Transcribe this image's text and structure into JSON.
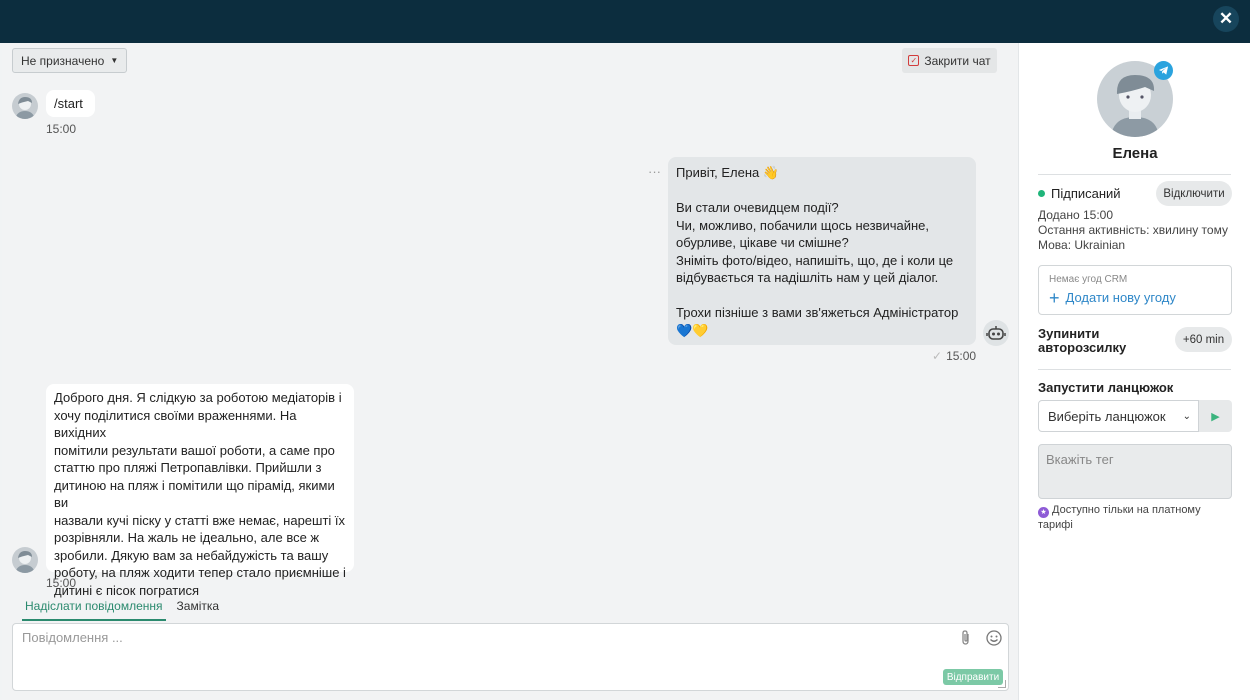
{
  "window": {
    "close_symbol": "✕"
  },
  "toolbar": {
    "assign_label": "Не призначено",
    "close_chat_label": "Закрити чат"
  },
  "messages": [
    {
      "direction": "incoming",
      "text": "/start",
      "time": "15:00"
    },
    {
      "direction": "outgoing",
      "sender": "bot",
      "lines": [
        "Привіт, Елена 👋",
        "",
        "Ви стали очевидцем події?",
        "Чи, можливо, побачили щось незвичайне,",
        "обурливе, цікаве чи смішне?",
        "Зніміть фото/відео, напишіть, що, де і коли це",
        "відбувається та надішліть нам у цей діалог.",
        "",
        "Трохи пізніше з вами зв'яжеться Адміністратор",
        "💙💛"
      ],
      "time": "15:00",
      "menu_symbol": "···"
    },
    {
      "direction": "incoming",
      "lines": [
        "Доброго дня. Я слідкую за роботою медіаторів і",
        "хочу поділитися своїми враженнями. На вихідних",
        "помітили результати вашої роботи, а саме про",
        "статтю про пляжі Петропавлівки. Прийшли з",
        "дитиною на пляж і помітили що пірамід, якими ви",
        "назвали кучі піску у статті вже немає, нарешті їх",
        "розрівняли. На жаль не ідеально, але все ж",
        "зробили. Дякую вам за небайдужість та вашу",
        "роботу, на пляж ходити тепер стало приємніше і",
        "дитині є пісок погратися"
      ],
      "time": "15:00"
    }
  ],
  "composer": {
    "tabs": [
      {
        "label": "Надіслати повідомлення",
        "active": true
      },
      {
        "label": "Замітка",
        "active": false
      }
    ],
    "placeholder": "Повідомлення ...",
    "send_label": "Відправити",
    "icons": [
      "paperclip-icon",
      "smile-icon"
    ]
  },
  "contact": {
    "name": "Елена",
    "channel": "telegram",
    "status": "Підписаний",
    "unsubscribe_label": "Відключити",
    "added": "Додано 15:00",
    "last_activity": "Остання активність: хвилину тому",
    "language": "Мова: Ukrainian"
  },
  "crm": {
    "empty_label": "Немає угод CRM",
    "add_label": "Додати нову угоду"
  },
  "autosend": {
    "stop_label": "Зупинити авторозсилку",
    "delay_label": "+60 min"
  },
  "chain": {
    "label": "Запустити ланцюжок",
    "select_placeholder": "Виберіть ланцюжок"
  },
  "tags": {
    "placeholder": "Вкажіть тег",
    "paid_note": "Доступно тільки на платному тарифі"
  },
  "colors": {
    "topbar": "#0c2d3e",
    "accent_green": "#2b8a6e",
    "link_blue": "#2e87c8",
    "status_green": "#1fb57a"
  }
}
